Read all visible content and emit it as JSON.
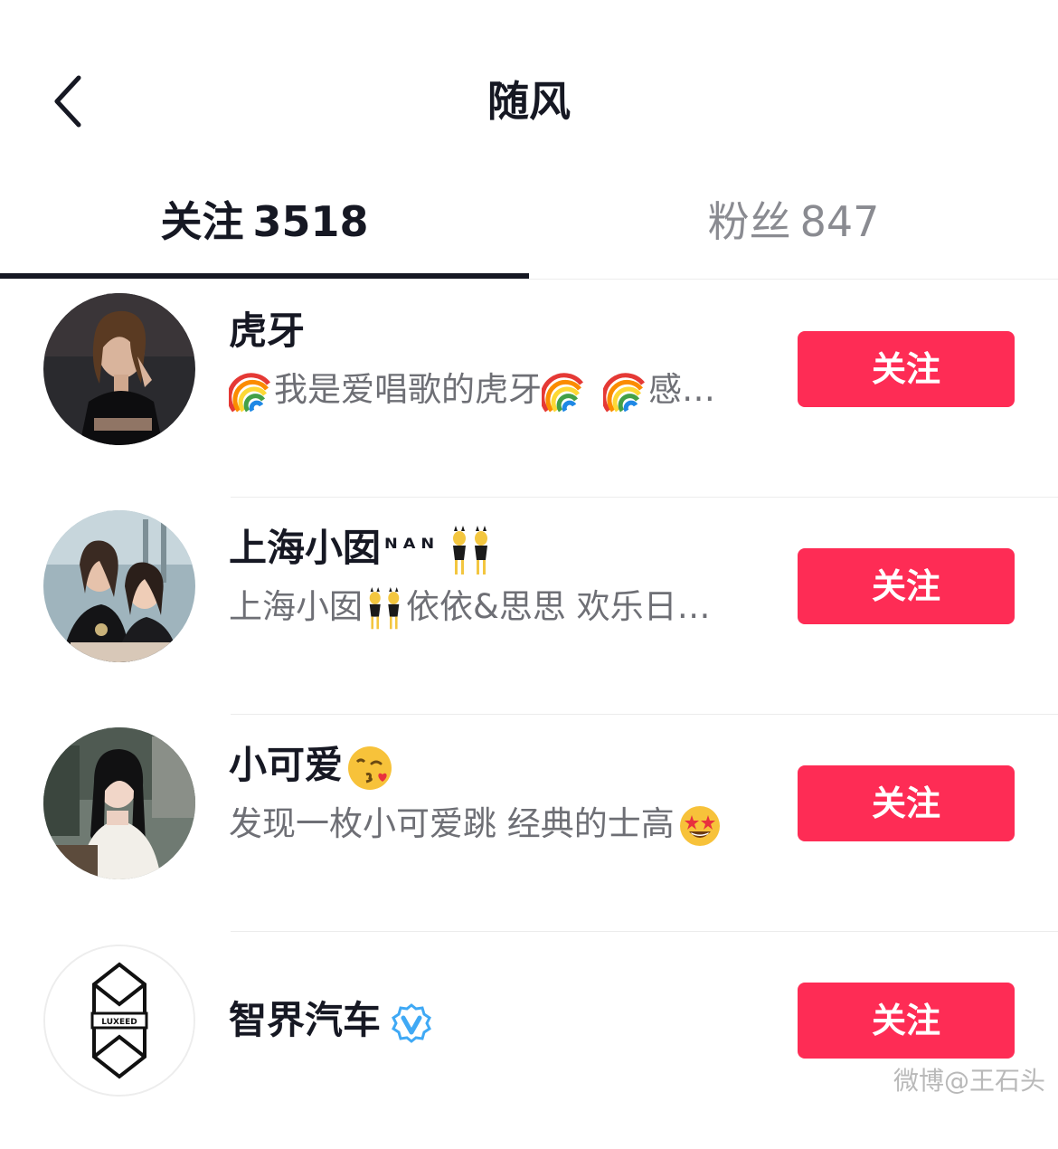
{
  "header": {
    "title": "随风",
    "back_icon": "chevron-left-icon"
  },
  "tabs": [
    {
      "label": "关注",
      "count": "3518",
      "active": true
    },
    {
      "label": "粉丝",
      "count": "847",
      "active": false
    }
  ],
  "users": [
    {
      "name": "虎牙",
      "subtitle_text_1": "我是爱唱歌的虎牙",
      "subtitle_text_2": "感…",
      "subtitle_emojis": [
        "rainbow-emoji",
        "rainbow-emoji",
        "rainbow-emoji"
      ],
      "follow_label": "关注"
    },
    {
      "name": "上海小囡",
      "name_suffix": "ᴺᴬᴺ",
      "name_emoji": "dancing-women-emoji",
      "subtitle_text_1": "上海小囡",
      "subtitle_text_2": "依依&思思 欢乐日…",
      "subtitle_emojis": [
        "dancing-women-emoji"
      ],
      "follow_label": "关注"
    },
    {
      "name": "小可爱",
      "name_emoji": "kiss-face-emoji",
      "subtitle_text_1": "发现一枚小可爱跳 经典的士高",
      "subtitle_emojis": [
        "star-struck-emoji"
      ],
      "follow_label": "关注"
    },
    {
      "name": "智界汽车",
      "verified_icon": "verified-badge-icon",
      "avatar_logo_text": "LUXEED",
      "follow_label": "关注"
    }
  ],
  "watermark": "微博@王石头",
  "colors": {
    "accent": "#fe2c55",
    "text_primary": "#161823",
    "text_secondary": "#6e6f75",
    "tab_inactive": "#8a8b91",
    "verified": "#3fa9f5"
  }
}
